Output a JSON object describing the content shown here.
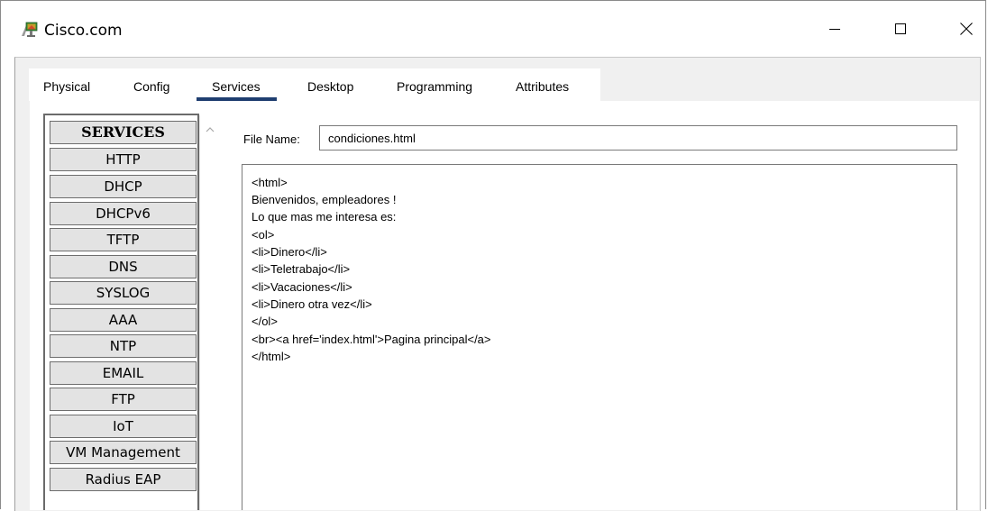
{
  "window": {
    "title": "Cisco.com",
    "minimize_icon": "minimize-icon",
    "maximize_icon": "maximize-icon",
    "close_icon": "close-icon",
    "app_icon": "packet-tracer-pc-icon"
  },
  "tabs": [
    {
      "label": "Physical"
    },
    {
      "label": "Config"
    },
    {
      "label": "Services",
      "active": true
    },
    {
      "label": "Desktop"
    },
    {
      "label": "Programming"
    },
    {
      "label": "Attributes"
    }
  ],
  "services": {
    "header": "SERVICES",
    "items": [
      "HTTP",
      "DHCP",
      "DHCPv6",
      "TFTP",
      "DNS",
      "SYSLOG",
      "AAA",
      "NTP",
      "EMAIL",
      "FTP",
      "IoT",
      "VM Management",
      "Radius EAP"
    ]
  },
  "file": {
    "label": "File Name:",
    "value": "condiciones.html"
  },
  "editor": {
    "lines": [
      "<html>",
      "Bienvenidos, empleadores !",
      "Lo que mas me interesa es:",
      "<ol>",
      "<li>Dinero</li>",
      "<li>Teletrabajo</li>",
      "<li>Vacaciones</li>",
      "<li>Dinero otra vez</li>",
      "</ol>",
      "<br><a href='index.html'>Pagina principal</a>",
      "</html>"
    ]
  },
  "colors": {
    "active_tab_underline": "#1f3e70",
    "service_button_bg": "#e3e3e3"
  }
}
